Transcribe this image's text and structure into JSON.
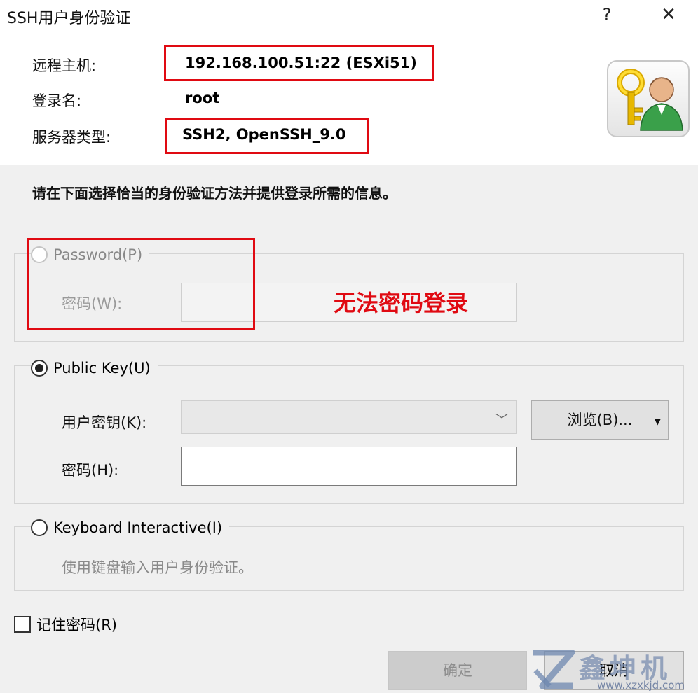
{
  "window": {
    "title": "SSH用户身份验证",
    "help": "?",
    "close": "✕"
  },
  "header": {
    "host_label": "远程主机:",
    "host_value": "192.168.100.51:22 (ESXi51)",
    "login_label": "登录名:",
    "login_value": "root",
    "server_type_label": "服务器类型:",
    "server_type_value": "SSH2, OpenSSH_9.0",
    "icon": "key-user-icon"
  },
  "instruction": "请在下面选择恰当的身份验证方法并提供登录所需的信息。",
  "password_group": {
    "radio_label": "Password(P)",
    "field_label": "密码(W):",
    "enabled": false,
    "selected": false
  },
  "annotation": "无法密码登录",
  "public_key_group": {
    "radio_label": "Public Key(U)",
    "selected": true,
    "user_key_label": "用户密钥(K):",
    "passphrase_label": "密码(H):",
    "browse_label": "浏览(B)..."
  },
  "keyboard_group": {
    "radio_label": "Keyboard Interactive(I)",
    "selected": false,
    "hint": "使用键盘输入用户身份验证。"
  },
  "remember_password": {
    "label": "记住密码(R)",
    "checked": false
  },
  "buttons": {
    "ok": "确定",
    "cancel": "取消"
  },
  "watermark": {
    "brand": "鑫坤机电",
    "url": "www.xzxkjd.com"
  },
  "colors": {
    "annotation_red": "#e00a12",
    "dialog_bg": "#f0f0f0"
  }
}
